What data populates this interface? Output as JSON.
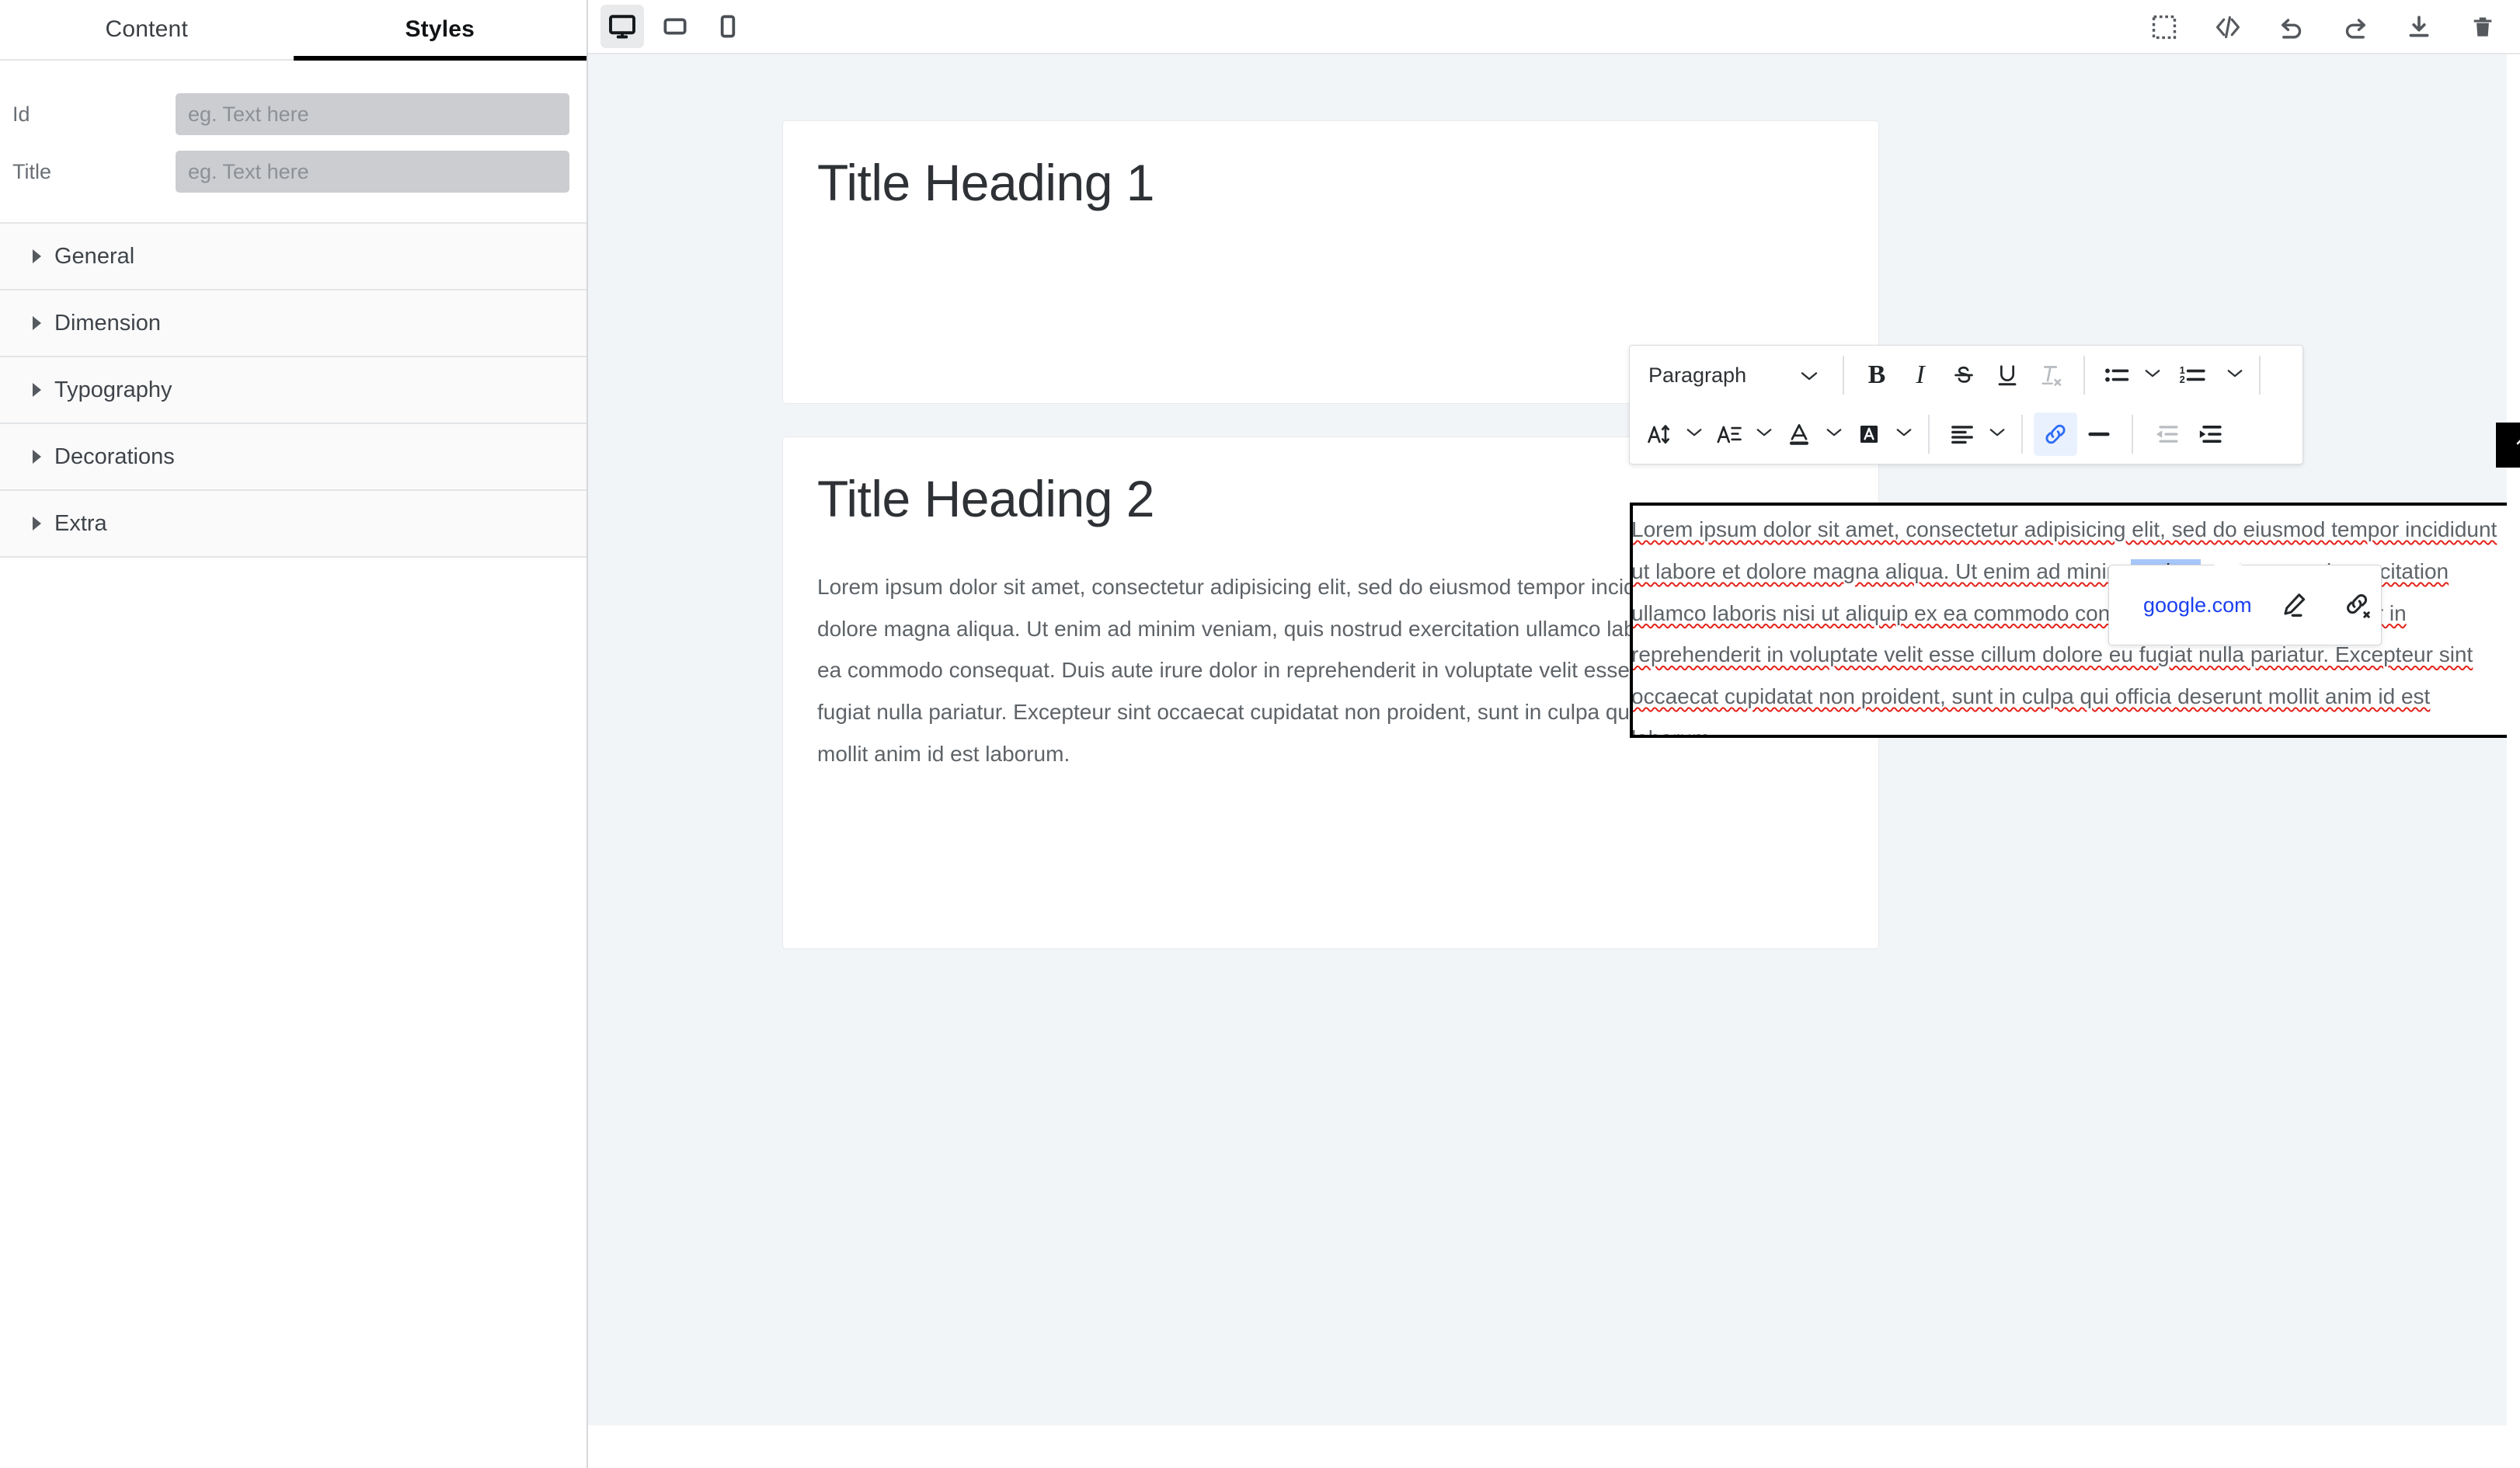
{
  "left_panel": {
    "tabs": [
      {
        "label": "Content",
        "active": false
      },
      {
        "label": "Styles",
        "active": true
      }
    ],
    "fields": [
      {
        "label": "Id",
        "value": "",
        "placeholder": "eg. Text here"
      },
      {
        "label": "Title",
        "value": "",
        "placeholder": "eg. Text here"
      }
    ],
    "accordion": [
      {
        "label": "General"
      },
      {
        "label": "Dimension"
      },
      {
        "label": "Typography"
      },
      {
        "label": "Decorations"
      },
      {
        "label": "Extra"
      }
    ]
  },
  "topbar": {
    "devices": [
      {
        "name": "desktop-view",
        "icon": "monitor-icon",
        "active": true
      },
      {
        "name": "tablet-view",
        "icon": "tablet-icon",
        "active": false
      },
      {
        "name": "mobile-view",
        "icon": "mobile-icon",
        "active": false
      }
    ],
    "actions": [
      {
        "name": "select-borders",
        "icon": "dashed-square-icon"
      },
      {
        "name": "open-code",
        "icon": "code-icon"
      },
      {
        "name": "undo",
        "icon": "undo-icon"
      },
      {
        "name": "redo",
        "icon": "redo-icon"
      },
      {
        "name": "import-download",
        "icon": "download-icon"
      },
      {
        "name": "clear-canvas",
        "icon": "trash-icon"
      }
    ]
  },
  "rte_toolbar": {
    "block_format": {
      "value": "Paragraph"
    },
    "row1": [
      {
        "name": "bold",
        "icon": "bold-icon",
        "label": "B"
      },
      {
        "name": "italic",
        "icon": "italic-icon",
        "label": "I"
      },
      {
        "name": "strikethrough",
        "icon": "strikethrough-icon"
      },
      {
        "name": "underline",
        "icon": "underline-icon"
      },
      {
        "name": "clear-format",
        "icon": "clear-format-icon",
        "disabled": true
      },
      {
        "name": "bullet-list",
        "icon": "bullet-list-icon",
        "has_caret": true
      },
      {
        "name": "numbered-list",
        "icon": "numbered-list-icon",
        "has_caret": true
      }
    ],
    "row2": [
      {
        "name": "font-size",
        "icon": "font-size-icon",
        "has_caret": true
      },
      {
        "name": "line-height",
        "icon": "line-height-icon",
        "has_caret": true
      },
      {
        "name": "font-color",
        "icon": "font-color-icon",
        "has_caret": true
      },
      {
        "name": "highlight-color",
        "icon": "highlight-color-icon",
        "has_caret": true
      },
      {
        "name": "text-align",
        "icon": "align-left-icon",
        "has_caret": true
      },
      {
        "name": "insert-link",
        "icon": "link-icon",
        "active": true
      },
      {
        "name": "horizontal-rule",
        "icon": "horizontal-rule-icon"
      },
      {
        "name": "outdent",
        "icon": "outdent-icon",
        "disabled": true
      },
      {
        "name": "indent",
        "icon": "indent-icon"
      }
    ]
  },
  "link_popup": {
    "url": "google.com",
    "actions": [
      {
        "name": "edit-link",
        "icon": "pencil-icon"
      },
      {
        "name": "unlink",
        "icon": "unlink-icon"
      }
    ]
  },
  "block_tools": [
    {
      "name": "select-parent",
      "icon": "arrow-up-icon"
    },
    {
      "name": "move-block",
      "icon": "move-icon"
    },
    {
      "name": "duplicate-block",
      "icon": "copy-icon"
    },
    {
      "name": "delete-block",
      "icon": "trash-icon"
    }
  ],
  "canvas": {
    "card1": {
      "heading": "Title Heading 1",
      "paragraph_line1": "Lorem ipsum dolor sit amet, consectetur adipisicing elit, sed do eiusmod tempor incididunt",
      "paragraph_line2a": "ut labore et dolore magna aliqua. Ut enim ad minim ",
      "paragraph_link": "veniam",
      "paragraph_line2b": ", quis nostrud exercitation",
      "paragraph_line3": "ullamco laboris nisi ut aliquip ex ea commodo consequat. Duis aute irure dolor in",
      "paragraph_line4": "reprehenderit in voluptate velit esse cillum dolore eu fugiat nulla pariatur. Excepteur sint",
      "paragraph_line5": "occaecat cupidatat non proident, sunt in culpa qui officia deserunt mollit anim id est",
      "paragraph_line6": "laborum."
    },
    "card2": {
      "heading": "Title Heading 2",
      "paragraph": "Lorem ipsum dolor sit amet, consectetur adipisicing elit, sed do eiusmod tempor incididunt ut labore et dolore magna aliqua. Ut enim ad minim veniam, quis nostrud exercitation ullamco laboris nisi ut aliquip ex ea commodo consequat. Duis aute irure dolor in reprehenderit in voluptate velit esse cillum dolore eu fugiat nulla pariatur. Excepteur sint occaecat cupidatat non proident, sunt in culpa qui officia deserunt mollit anim id est laborum."
    }
  },
  "colors": {
    "accent_link": "#1a3ff0",
    "selection": "#a8c7fa",
    "spellcheck": "#e5231b",
    "canvas_bg": "#f2f5f8",
    "tab_underline": "#000000",
    "block_toolbar_bg": "#000000"
  }
}
